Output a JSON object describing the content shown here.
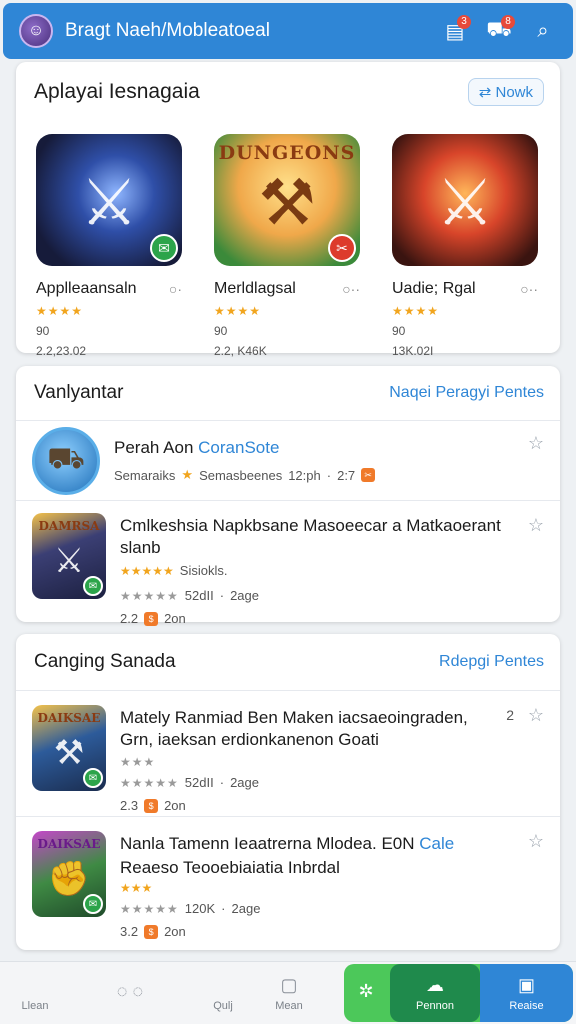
{
  "appbar": {
    "title": "Bragt Naeh/Mobleatoeal",
    "badge_1": "3",
    "badge_2": "8"
  },
  "featured": {
    "title": "Aplayai Iesnagaia",
    "more_label": "Nowk",
    "apps": [
      {
        "name": "Applleaansaln",
        "logo": "",
        "reviews": "90",
        "meta": "2.2,23.02",
        "badge": "green"
      },
      {
        "name": "Merldlagsal",
        "logo": "DUNGEONS",
        "reviews": "90",
        "meta": "2.2, K46K",
        "badge": "red"
      },
      {
        "name": "Uadie; Rgal",
        "logo": "",
        "reviews": "90",
        "meta": "13K.02I",
        "badge": ""
      }
    ]
  },
  "section2": {
    "title": "Vanlyantar",
    "link": "Naqei Peragyi Pentes",
    "items": [
      {
        "title": "Perah Aon",
        "title_accent": "CoranSote",
        "sub_left": "Semaraiks",
        "sub_mid": "Semasbeenes",
        "sub_time": "12:ph",
        "sub_count": "2:7"
      },
      {
        "logo": "DAMRSA",
        "title": "Cmlkeshsia Napkbsane Masoeecar a Matkaoerant slanb",
        "line2": "Sisiokls.",
        "size": "52dII",
        "age": "2age",
        "price": "2.2",
        "extra": "2on"
      }
    ]
  },
  "section3": {
    "title": "Canging Sanada",
    "link": "Rdepgi Pentes",
    "items": [
      {
        "logo": "DAIKSAE",
        "title": "Mately Ranmiad Ben Maken iacsaeoingraden, Grn, iaeksan erdionkanenon Goati",
        "count": "2",
        "size": "52dII",
        "age": "2age",
        "price": "2.3",
        "extra": "2on"
      },
      {
        "logo": "DAIKSAE",
        "title": "Nanla Tamenn Ieaatrerna Mlodea. E0N",
        "title_accent": "Cale",
        "line2": "Reaeso Teooebiaiatia Inbrdal",
        "size": "120K",
        "age": "2age",
        "price": "3.2",
        "extra": "2on"
      }
    ]
  },
  "bottom_nav": {
    "items": [
      {
        "label": "Llean"
      },
      {
        "label": ""
      },
      {
        "label": "Qulj"
      },
      {
        "label": "Mean"
      },
      {
        "label": ""
      },
      {
        "label": "Pennon"
      },
      {
        "label": "Reaise"
      }
    ]
  },
  "colors": {
    "primary": "#2f86d6",
    "star": "#f1a51e",
    "green": "#4cc85a",
    "dark_green": "#1f8a4c"
  }
}
